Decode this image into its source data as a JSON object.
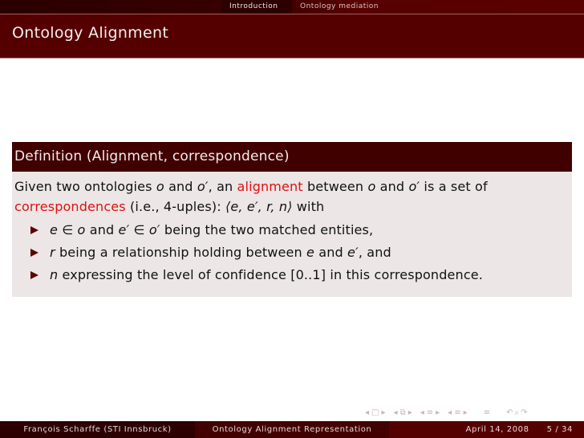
{
  "headline": {
    "sections": [
      {
        "label": "Introduction",
        "current": true
      },
      {
        "label": "Ontology mediation",
        "current": false
      }
    ]
  },
  "frame": {
    "title": "Ontology Alignment"
  },
  "definition": {
    "title": "Definition (Alignment, correspondence)",
    "line1": {
      "t1": "Given two ontologies ",
      "o": "o",
      "t2": " and ",
      "o_prime": "o′",
      "t3": ", an ",
      "alert": "alignment",
      "t4": " between ",
      "o2": "o",
      "t5": " and ",
      "o2_prime": "o′",
      "t6": " is a set of"
    },
    "line2": {
      "alert": "correspondences",
      "t1": " (i.e., 4-uples): ",
      "tuple": "⟨e, e′, r, n⟩",
      "t2": " with"
    },
    "items": [
      {
        "m1": "e ∈ o",
        "t1": " and ",
        "m2": "e′ ∈ o′",
        "t2": " being the two matched entities,"
      },
      {
        "m1": "r",
        "t1": " being a relationship holding between ",
        "m2": "e",
        "t2": " and ",
        "m3": "e′",
        "t3": ", and"
      },
      {
        "m1": "n",
        "t1": " expressing the level of confidence [0..1] in this correspondence."
      }
    ]
  },
  "navigation": {
    "icons": [
      "nav-frame-left",
      "nav-frame",
      "nav-frame-right",
      "nav-subsection-left",
      "nav-subsection",
      "nav-subsection-right",
      "nav-section-left",
      "nav-section",
      "nav-section-right",
      "nav-subsubsection-left",
      "nav-subsubsection",
      "nav-subsubsection-right",
      "nav-document",
      "nav-back",
      "nav-search",
      "nav-forward"
    ],
    "glyphs": {
      "left": "◂",
      "right": "▸",
      "frame": "□",
      "subsection": "⧉",
      "section": "≡",
      "doc": "≡",
      "back": "↶",
      "search": "⌕",
      "forward": "↷"
    }
  },
  "footer": {
    "author": "François Scharffe  (STI Innsbruck)",
    "title": "Ontology Alignment Representation",
    "date": "April 14, 2008",
    "page": "5 / 34"
  }
}
